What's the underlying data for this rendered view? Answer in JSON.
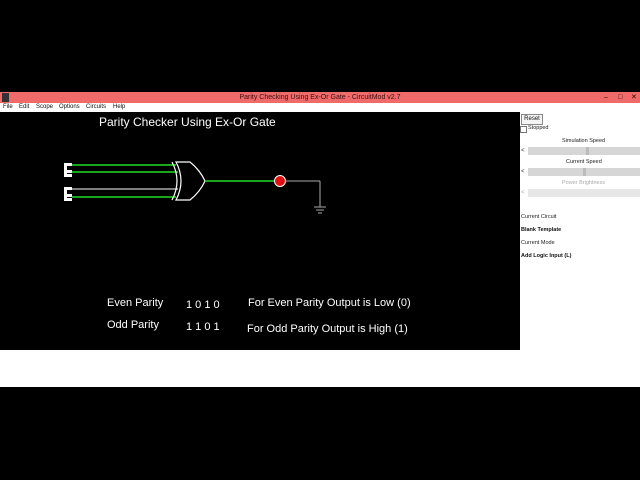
{
  "window": {
    "title": "Parity Checking Using Ex-Or Gate - CircuitMod v2.7",
    "controls": [
      "–",
      "□",
      "✕"
    ]
  },
  "menu": [
    "File",
    "Edit",
    "Scope",
    "Options",
    "Circuits",
    "Help"
  ],
  "canvas": {
    "heading": "Parity Checker Using Ex-Or Gate",
    "even_label": "Even Parity",
    "even_bits": "1 0 1 0",
    "even_note": "For Even Parity Output is Low (0)",
    "odd_label": "Odd Parity",
    "odd_bits": "1 1 0 1",
    "odd_note": "For Odd Parity Output is High (1)",
    "led_color": "#e01010",
    "wire_active_color": "#22dd22",
    "wire_idle_color": "#aaaaaa"
  },
  "side": {
    "reset_label": "Reset",
    "stopped_label": "Stopped",
    "stopped_checked": false,
    "sim_speed_label": "Simulation Speed",
    "current_speed_label": "Current Speed",
    "power_brightness_label": "Power Brightness",
    "current_circuit_label": "Current Circuit",
    "current_circuit_value": "Blank Template",
    "current_mode_label": "Current Mode",
    "current_mode_value": "Add Logic Input (L)",
    "arrow_glyph": "<"
  }
}
